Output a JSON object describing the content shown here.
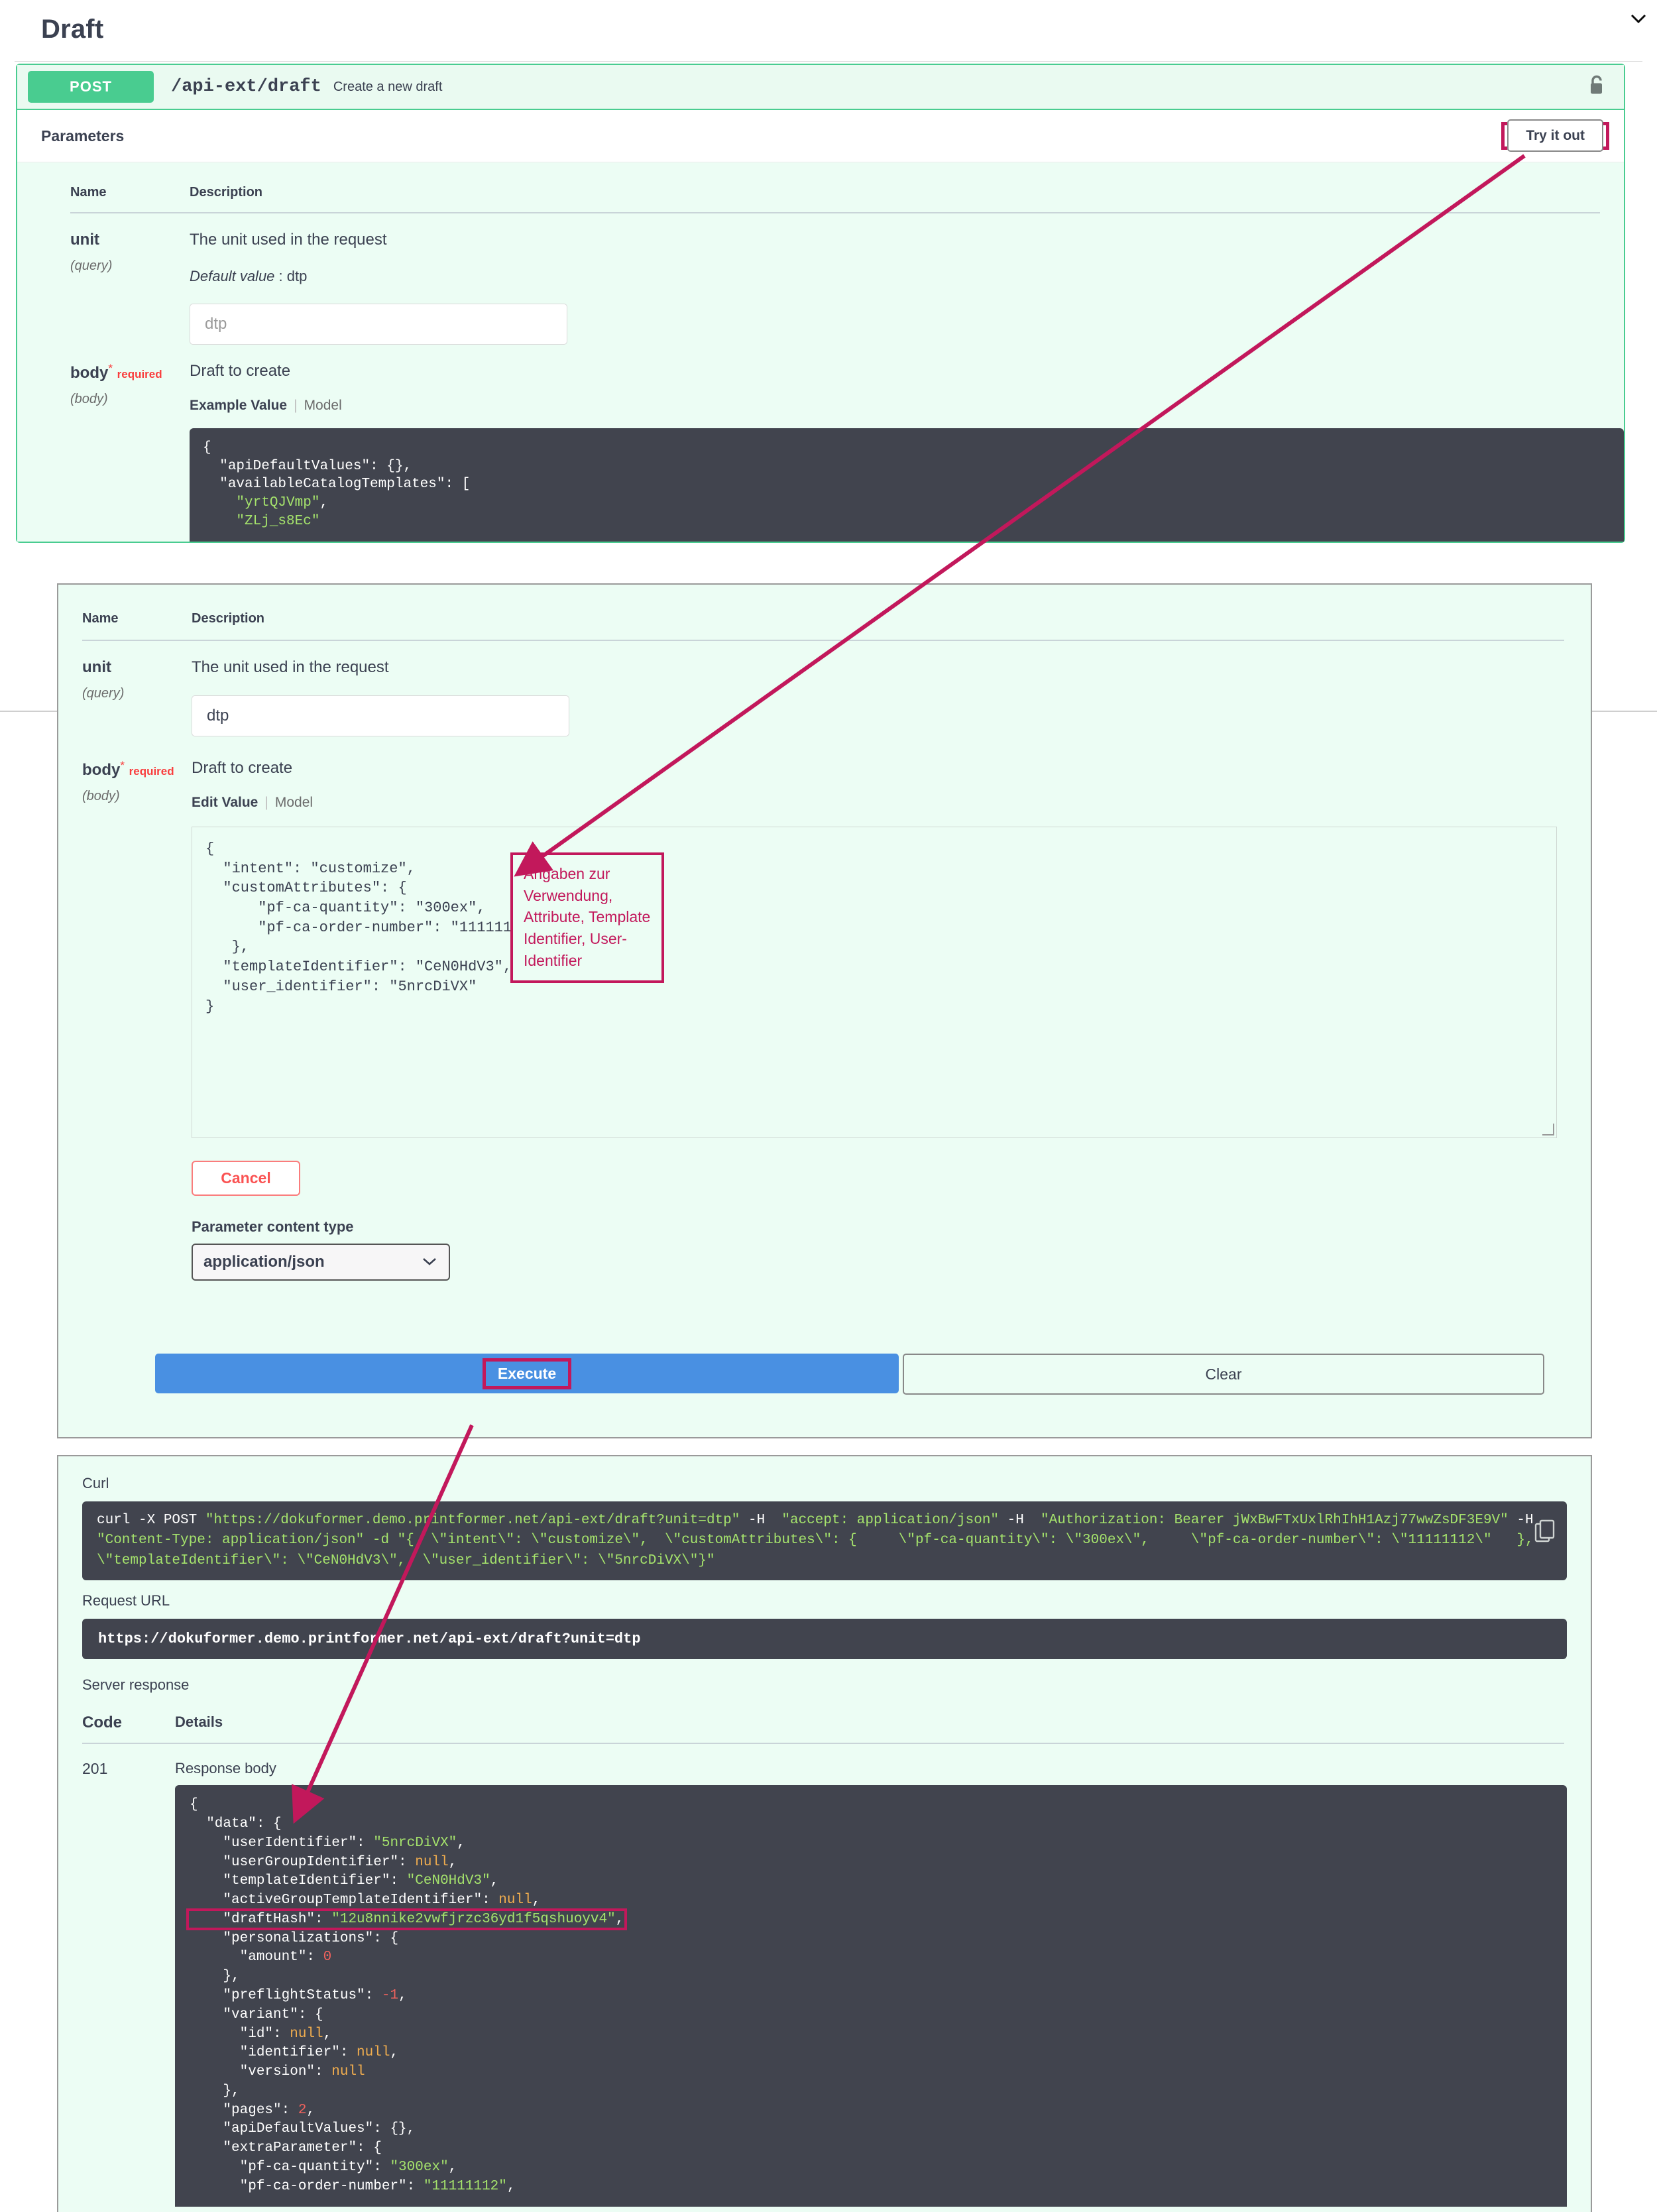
{
  "header": {
    "title": "Draft",
    "collapse_icon": "chevron-down-icon"
  },
  "operation": {
    "method": "POST",
    "path": "/api-ext/draft",
    "summary": "Create a new draft",
    "auth_icon": "unlock-icon",
    "parameters_label": "Parameters",
    "try_it_out_label": "Try it out"
  },
  "table_headers": {
    "name": "Name",
    "description": "Description",
    "code": "Code",
    "details": "Details"
  },
  "params": {
    "unit": {
      "name": "unit",
      "in": "(query)",
      "description": "The unit used in the request",
      "default_label": "Default value",
      "default_value": "dtp",
      "placeholder": "dtp",
      "value": "dtp"
    },
    "body": {
      "name": "body",
      "required_star": "*",
      "required_word": "required",
      "in": "(body)",
      "description": "Draft to create",
      "tab_example": "Example Value",
      "tab_model": "Model",
      "tab_edit": "Edit Value",
      "example_code": "{\n  \"apiDefaultValues\": {},\n  \"availableCatalogTemplates\": [\n    \"yrtQJVmp\",\n    \"ZLj_s8Ec\"",
      "edit_value": "{\n  \"intent\": \"customize\",\n  \"customAttributes\": {\n      \"pf-ca-quantity\": \"300ex\",\n      \"pf-ca-order-number\": \"11111112\"\n   },\n  \"templateIdentifier\": \"CeN0HdV3\",\n  \"user_identifier\": \"5nrcDiVX\"\n}"
    }
  },
  "annotation": {
    "text": "Angaben zur Verwendung, Attribute, Template Identifier, User-Identifier",
    "color": "#c2185b"
  },
  "actions": {
    "cancel": "Cancel",
    "content_type_label": "Parameter content type",
    "content_type_value": "application/json",
    "execute": "Execute",
    "clear": "Clear"
  },
  "response": {
    "curl_label": "Curl",
    "curl_line1_a": "curl -X POST ",
    "curl_line1_b": "\"https://dokuformer.demo.printformer.net/api-ext/draft?unit=dtp\"",
    "curl_line1_c": " -H  ",
    "curl_line1_d": "\"accept: application/json\"",
    "curl_line1_e": " -H  ",
    "curl_line1_f": "\"Authorization: Bearer jWxBwFTxUxlRhIhH1Azj77wwZsDF3E9V\"",
    "curl_line1_g": " -H",
    "curl_line2": "\"Content-Type: application/json\" -d \"{  \\\"intent\\\": \\\"customize\\\",  \\\"customAttributes\\\": {     \\\"pf-ca-quantity\\\": \\\"300ex\\\",     \\\"pf-ca-order-number\\\": \\\"11111112\\\"   },",
    "curl_line3": "\\\"templateIdentifier\\\": \\\"CeN0HdV3\\\",  \\\"user_identifier\\\": \\\"5nrcDiVX\\\"}\"",
    "copy_icon": "copy-icon",
    "request_url_label": "Request URL",
    "request_url": "https://dokuformer.demo.printformer.net/api-ext/draft?unit=dtp",
    "server_response_label": "Server response",
    "status_code": "201",
    "response_body_label": "Response body",
    "draft_hash_value": "12u8nnike2vwfjrzc36yd1f5qshuoyv4"
  },
  "response_json": {
    "open": "{",
    "data_key": "  \"data\": {",
    "lines": [
      {
        "indent": 4,
        "key": "\"userIdentifier\"",
        "val": "\"5nrcDiVX\"",
        "type": "str",
        "comma": true
      },
      {
        "indent": 4,
        "key": "\"userGroupIdentifier\"",
        "val": "null",
        "type": "nul",
        "comma": true
      },
      {
        "indent": 4,
        "key": "\"templateIdentifier\"",
        "val": "\"CeN0HdV3\"",
        "type": "str",
        "comma": true
      },
      {
        "indent": 4,
        "key": "\"activeGroupTemplateIdentifier\"",
        "val": "null",
        "type": "nul",
        "comma": true
      },
      {
        "indent": 4,
        "key": "\"draftHash\"",
        "val": "\"12u8nnike2vwfjrzc36yd1f5qshuoyv4\"",
        "type": "str",
        "comma": true,
        "highlight": true
      },
      {
        "indent": 4,
        "key": "\"personalizations\"",
        "val": "{",
        "type": "plain",
        "comma": false
      },
      {
        "indent": 6,
        "key": "\"amount\"",
        "val": "0",
        "type": "num",
        "comma": false
      },
      {
        "indent": 4,
        "raw": "},",
        "type": "plain"
      },
      {
        "indent": 4,
        "key": "\"preflightStatus\"",
        "val": "-1",
        "type": "num",
        "comma": true
      },
      {
        "indent": 4,
        "key": "\"variant\"",
        "val": "{",
        "type": "plain",
        "comma": false
      },
      {
        "indent": 6,
        "key": "\"id\"",
        "val": "null",
        "type": "nul",
        "comma": true
      },
      {
        "indent": 6,
        "key": "\"identifier\"",
        "val": "null",
        "type": "nul",
        "comma": true
      },
      {
        "indent": 6,
        "key": "\"version\"",
        "val": "null",
        "type": "nul",
        "comma": false
      },
      {
        "indent": 4,
        "raw": "},",
        "type": "plain"
      },
      {
        "indent": 4,
        "key": "\"pages\"",
        "val": "2",
        "type": "num",
        "comma": true
      },
      {
        "indent": 4,
        "key": "\"apiDefaultValues\"",
        "val": "{},",
        "type": "plain",
        "comma": false
      },
      {
        "indent": 4,
        "key": "\"extraParameter\"",
        "val": "{",
        "type": "plain",
        "comma": false
      },
      {
        "indent": 6,
        "key": "\"pf-ca-quantity\"",
        "val": "\"300ex\"",
        "type": "str",
        "comma": true
      },
      {
        "indent": 6,
        "key": "\"pf-ca-order-number\"",
        "val": "\"11111112\"",
        "type": "str",
        "comma": true
      }
    ]
  },
  "colors": {
    "method_green": "#49cc90",
    "panel_bg": "#ecfdf4",
    "code_bg": "#41444e",
    "string_green": "#a5e36c",
    "null_orange": "#f0ad4e",
    "number_red": "#f0625d",
    "accent_pink": "#c2185b",
    "execute_blue": "#4990e2",
    "cancel_red": "#fa5252"
  }
}
